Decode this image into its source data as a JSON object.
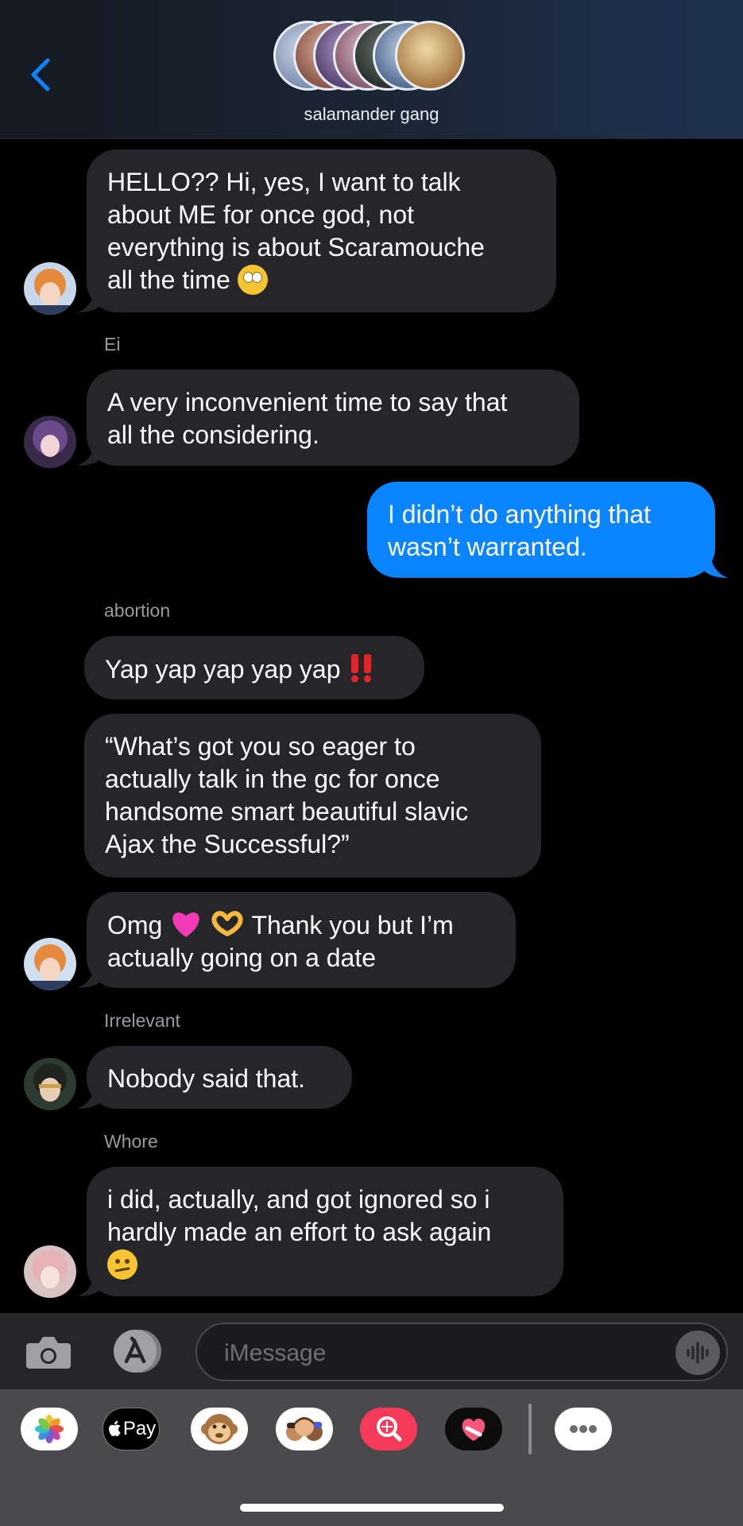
{
  "header": {
    "group_name": "salamander gang"
  },
  "messages": {
    "m1": [
      "HELLO?? Hi, yes, I want to talk",
      "about ME for once god, not",
      "everything is about Scaramouche",
      "all the time"
    ],
    "sender_ei": "Ei",
    "m2": [
      "A very inconvenient time to say that",
      "all the considering."
    ],
    "m3": [
      "I didn’t do anything that",
      "wasn’t warranted."
    ],
    "sender_abortion": "abortion",
    "m4": "Yap yap yap yap yap",
    "m5": [
      "“What’s got you so eager to",
      "actually talk in the gc for once",
      "handsome smart beautiful slavic",
      "Ajax the Successful?”"
    ],
    "m6_a": "Omg",
    "m6_b": "Thank you but I’m",
    "m6_c": "actually going on a date",
    "sender_irrelevant": "Irrelevant",
    "m7": "Nobody said that.",
    "sender_whore": "Whore",
    "m8": [
      "i did, actually, and got ignored so i",
      "hardly made an effort to ask again"
    ]
  },
  "input": {
    "placeholder": "iMessage"
  },
  "app_drawer": {
    "applepay_label": "Pay",
    "apps": [
      "photos-icon",
      "apple-pay-icon",
      "animoji-icon",
      "memoji-icon",
      "image-search-icon",
      "digital-touch-icon",
      "more-icon"
    ]
  },
  "colors": {
    "incoming_bubble": "#26262a",
    "outgoing_bubble": "#0a84ff",
    "accent": "#0a84ff"
  }
}
